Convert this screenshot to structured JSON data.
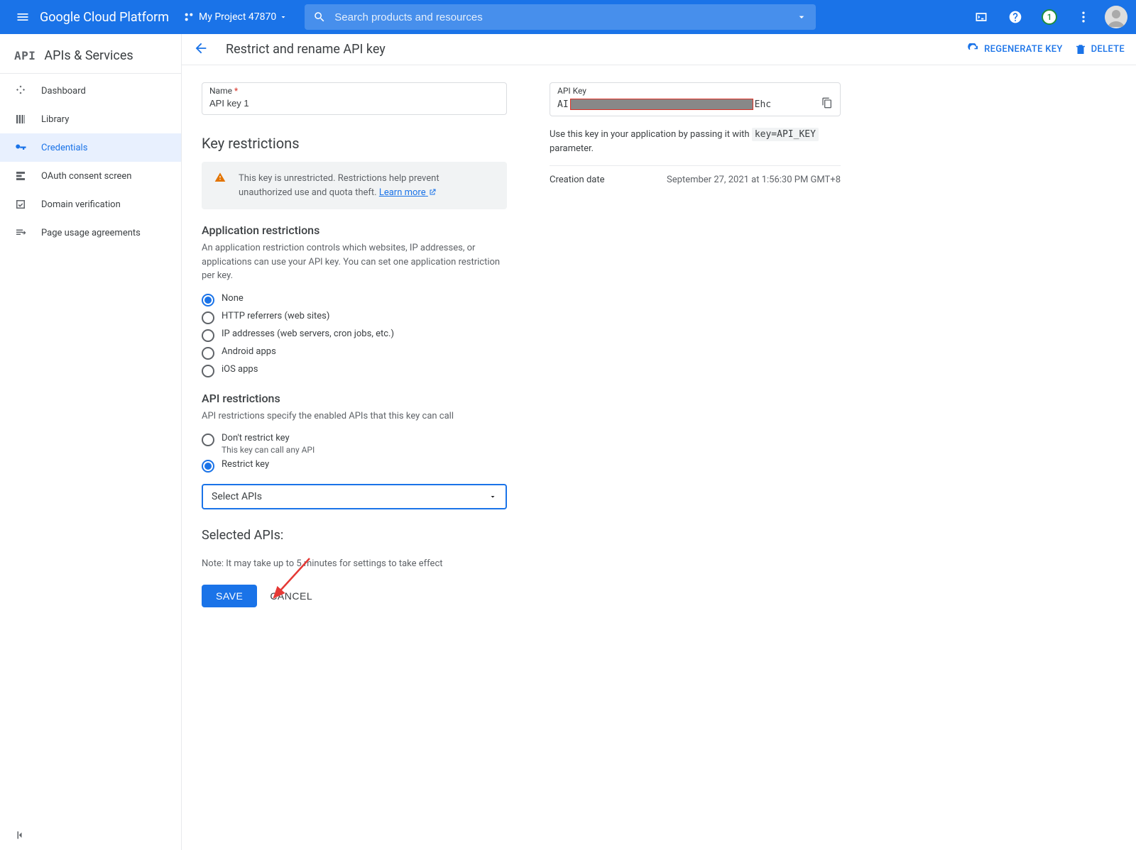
{
  "topbar": {
    "logo": "Google Cloud Platform",
    "project": "My Project 47870",
    "search_placeholder": "Search products and resources",
    "notif_count": "1"
  },
  "sidebar": {
    "heading": "APIs & Services",
    "items": [
      {
        "label": "Dashboard"
      },
      {
        "label": "Library"
      },
      {
        "label": "Credentials"
      },
      {
        "label": "OAuth consent screen"
      },
      {
        "label": "Domain verification"
      },
      {
        "label": "Page usage agreements"
      }
    ]
  },
  "actionbar": {
    "title": "Restrict and rename API key",
    "regenerate": "Regenerate Key",
    "delete": "Delete"
  },
  "form": {
    "name_label": "Name",
    "name_value": "API key 1",
    "key_restrictions_heading": "Key restrictions",
    "alert_text": "This key is unrestricted. Restrictions help prevent unauthorized use and quota theft. ",
    "alert_link": "Learn more",
    "app_restrictions_heading": "Application restrictions",
    "app_restrictions_desc": "An application restriction controls which websites, IP addresses, or applications can use your API key. You can set one application restriction per key.",
    "app_options": [
      "None",
      "HTTP referrers (web sites)",
      "IP addresses (web servers, cron jobs, etc.)",
      "Android apps",
      "iOS apps"
    ],
    "api_restrictions_heading": "API restrictions",
    "api_restrictions_desc": "API restrictions specify the enabled APIs that this key can call",
    "api_opt1_label": "Don't restrict key",
    "api_opt1_sub": "This key can call any API",
    "api_opt2_label": "Restrict key",
    "select_placeholder": "Select APIs",
    "selected_heading": "Selected APIs:",
    "footer_note": "Note: It may take up to 5 minutes for settings to take effect",
    "save": "SAVE",
    "cancel": "CANCEL"
  },
  "right": {
    "api_key_label": "API Key",
    "api_key_prefix": "AI",
    "api_key_suffix": "Ehc",
    "hint_pre": "Use this key in your application by passing it with ",
    "hint_code": "key=API_KEY",
    "hint_post": " parameter.",
    "creation_label": "Creation date",
    "creation_value": "September 27, 2021 at 1:56:30 PM GMT+8"
  }
}
